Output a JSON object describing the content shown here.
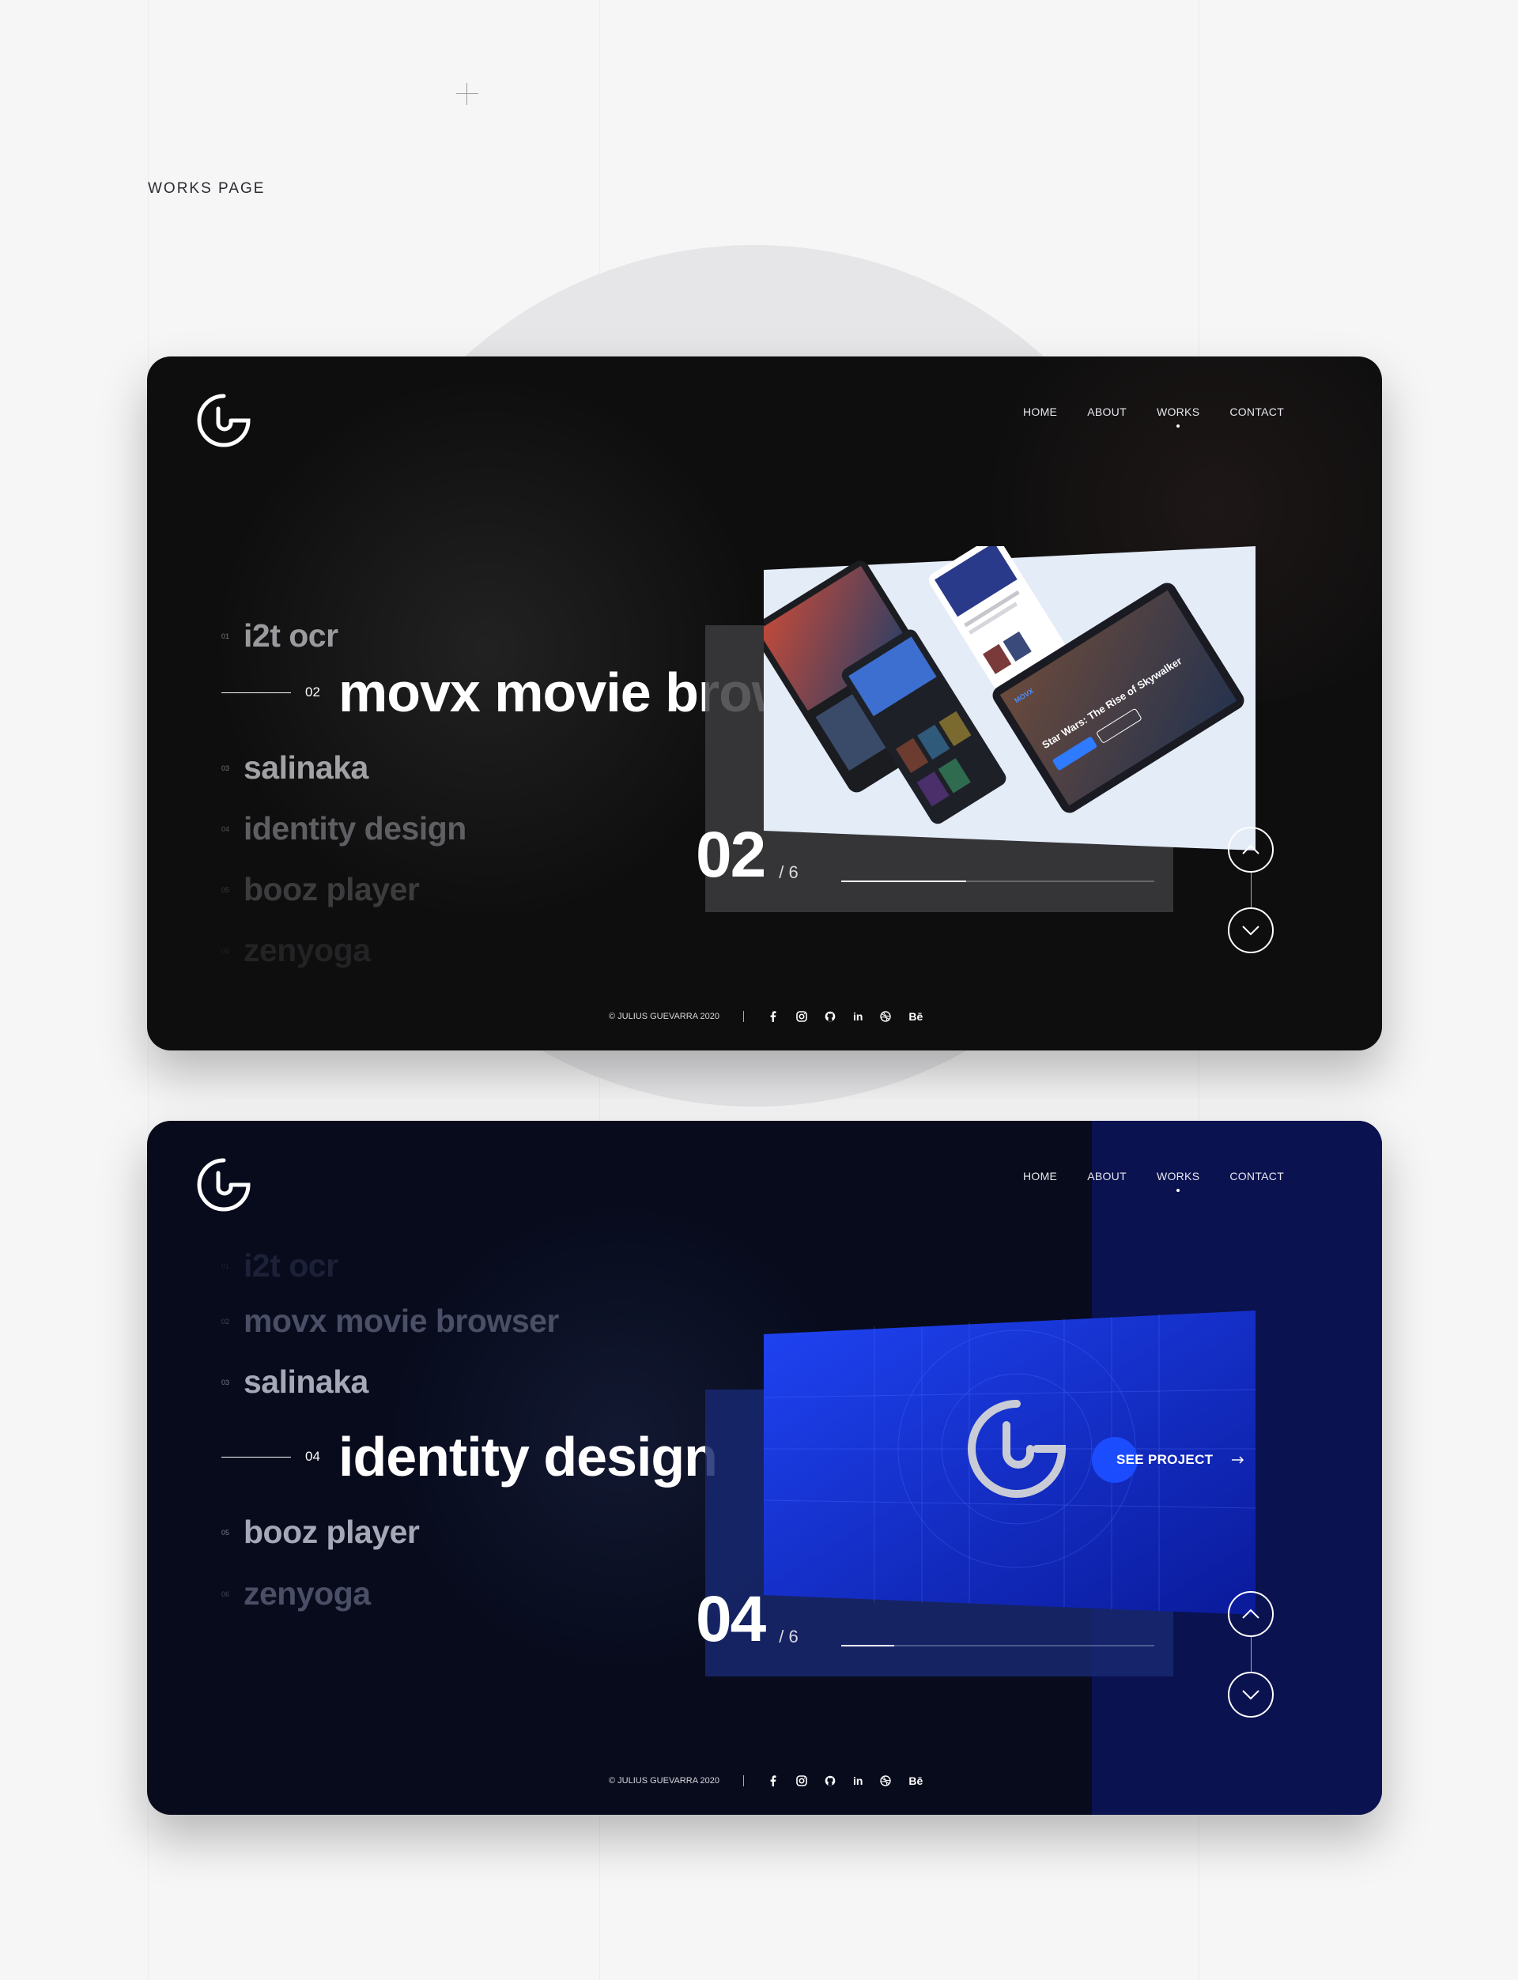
{
  "page": {
    "label": "WORKS PAGE"
  },
  "nav": {
    "home": "HOME",
    "about": "ABOUT",
    "works": "WORKS",
    "contact": "CONTACT"
  },
  "works": [
    {
      "num": "01",
      "title": "i2t ocr"
    },
    {
      "num": "02",
      "title": "movx movie browser"
    },
    {
      "num": "03",
      "title": "salinaka"
    },
    {
      "num": "04",
      "title": "identity design"
    },
    {
      "num": "05",
      "title": "booz player"
    },
    {
      "num": "06",
      "title": "zenyoga"
    }
  ],
  "slide1": {
    "current": "02",
    "total": "/ 6",
    "progress": 0.4
  },
  "slide2": {
    "current": "04",
    "total": "/ 6",
    "progress": 0.17,
    "cta": "SEE PROJECT"
  },
  "footer": {
    "copyright": "© JULIUS GUEVARRA 2020",
    "behance": "Bē",
    "linkedin": "in"
  },
  "mockup": {
    "movie_title": "Star Wars: The Rise of Skywalker",
    "brand": "MOVX"
  },
  "colors": {
    "card1_bg": "#0e0e0e",
    "card2_bg": "#070b1c",
    "accent_blue": "#1b4dff"
  },
  "icons": [
    "logo-icon",
    "chevron-up-icon",
    "chevron-down-icon",
    "facebook-icon",
    "instagram-icon",
    "github-icon",
    "linkedin-icon",
    "dribbble-icon",
    "behance-icon",
    "arrow-right-icon"
  ]
}
